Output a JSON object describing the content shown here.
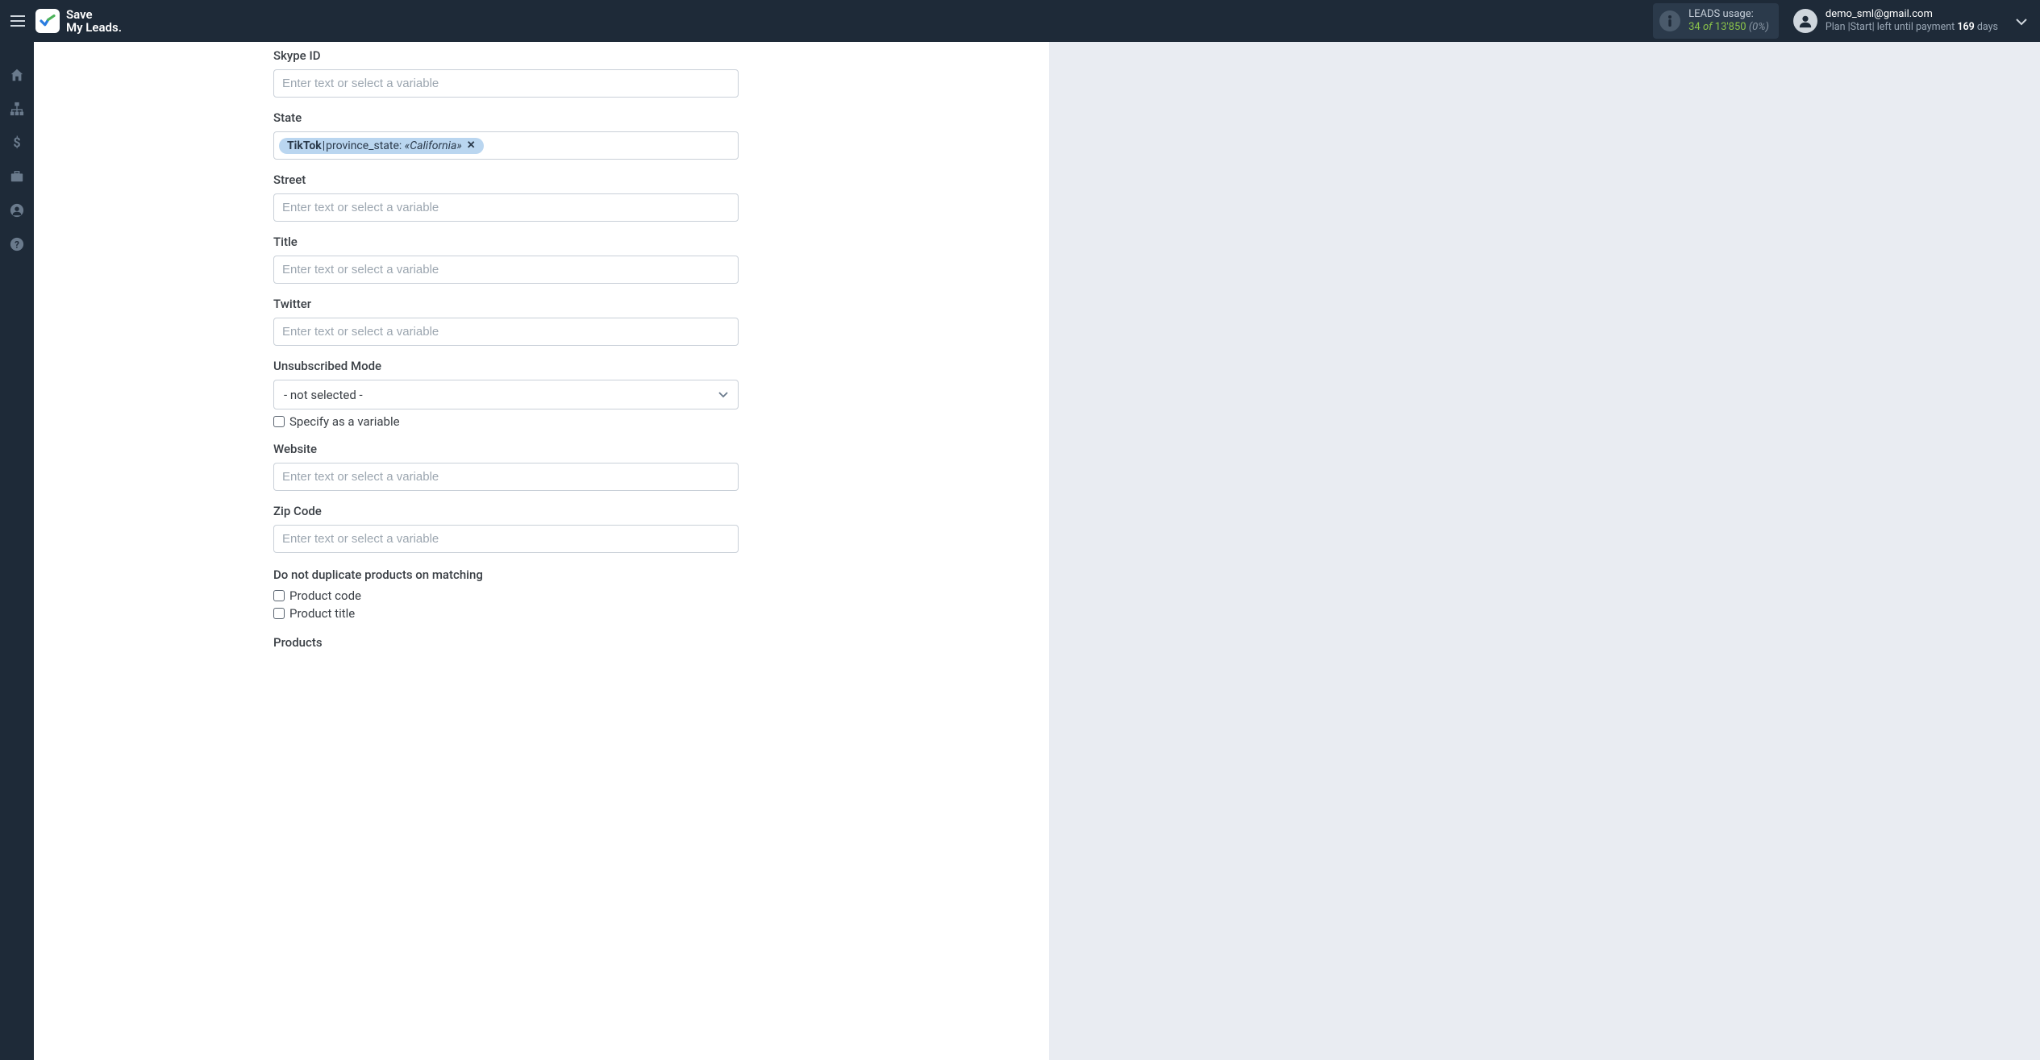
{
  "header": {
    "brand_line1": "Save",
    "brand_line2": "My Leads.",
    "usage": {
      "label": "LEADS usage:",
      "used": "34",
      "of": "of",
      "total": "13'850",
      "percent": "(0%)"
    },
    "user": {
      "email": "demo_sml@gmail.com",
      "plan_prefix": "Plan |Start| left until payment ",
      "days": "169",
      "days_suffix": " days"
    }
  },
  "fields": {
    "skype": {
      "label": "Skype ID",
      "placeholder": "Enter text or select a variable"
    },
    "state": {
      "label": "State",
      "chip": {
        "source": "TikTok",
        "key": "province_state:",
        "value": "«California»"
      }
    },
    "street": {
      "label": "Street",
      "placeholder": "Enter text or select a variable"
    },
    "title": {
      "label": "Title",
      "placeholder": "Enter text or select a variable"
    },
    "twitter": {
      "label": "Twitter",
      "placeholder": "Enter text or select a variable"
    },
    "unsub": {
      "label": "Unsubscribed Mode",
      "selected": "- not selected -",
      "specify": "Specify as a variable"
    },
    "website": {
      "label": "Website",
      "placeholder": "Enter text or select a variable"
    },
    "zip": {
      "label": "Zip Code",
      "placeholder": "Enter text or select a variable"
    },
    "dedupe": {
      "label": "Do not duplicate products on matching",
      "opt1": "Product code",
      "opt2": "Product title"
    },
    "products": {
      "label": "Products"
    }
  }
}
